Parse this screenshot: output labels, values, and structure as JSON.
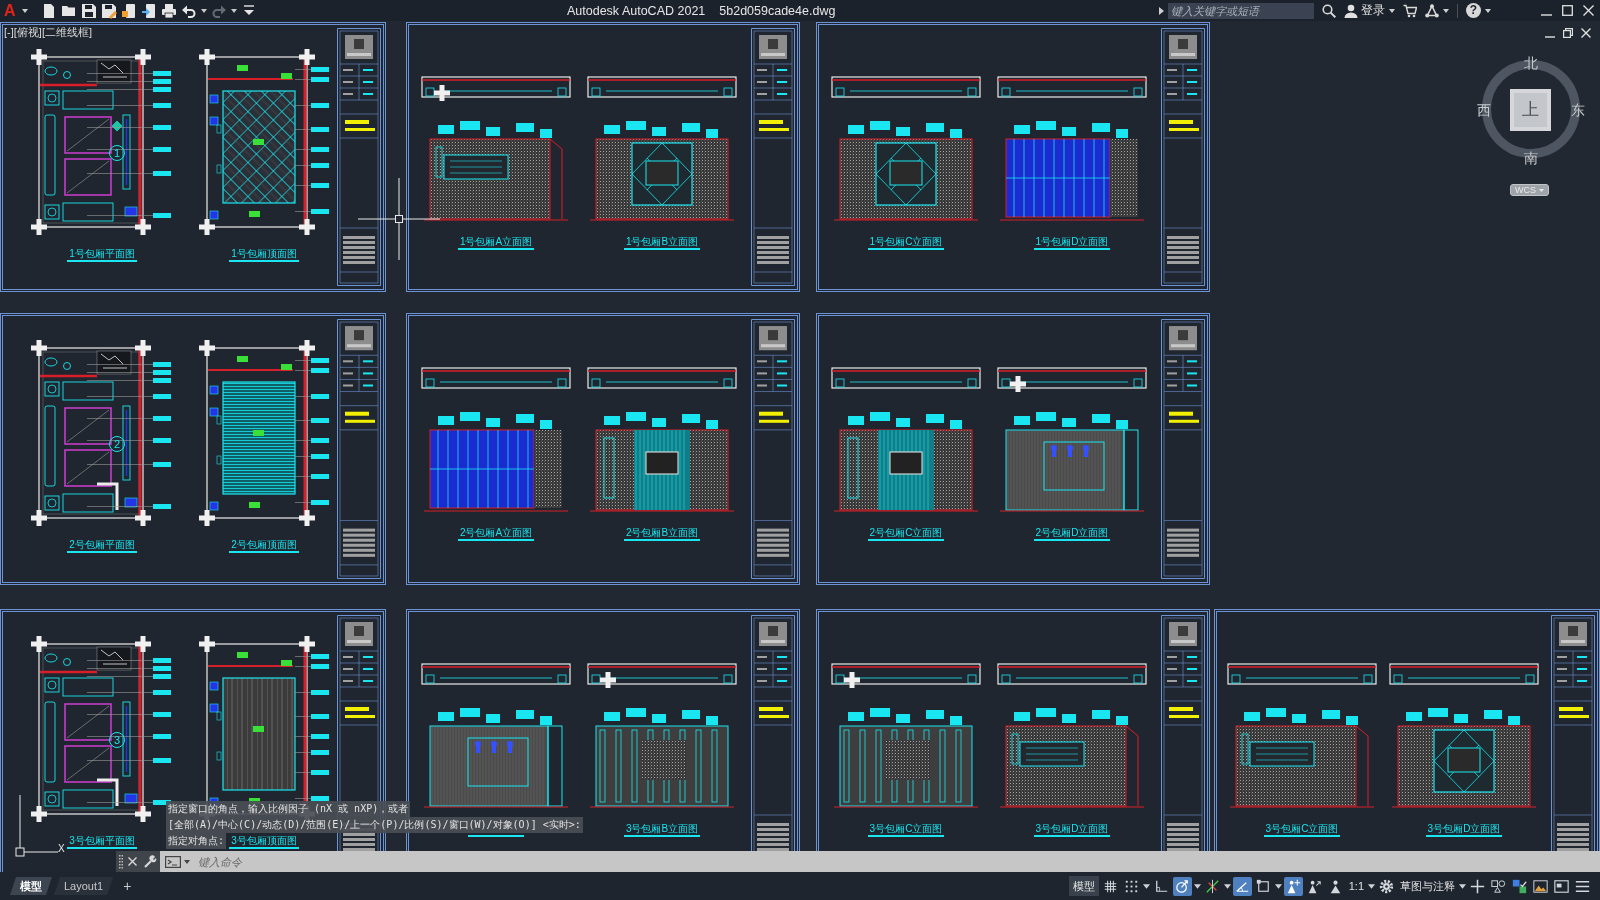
{
  "title_bar": {
    "logo": "A",
    "quick_access": [
      {
        "kind": "new"
      },
      {
        "kind": "open"
      },
      {
        "kind": "save"
      },
      {
        "kind": "saveas"
      },
      {
        "kind": "webopen"
      },
      {
        "kind": "websave"
      },
      {
        "kind": "plot"
      },
      {
        "kind": "undo",
        "disabled": false
      },
      {
        "kind": "caret"
      },
      {
        "kind": "redo",
        "disabled": true
      },
      {
        "kind": "caret"
      },
      {
        "kind": "customize"
      }
    ],
    "app_name": "Autodesk AutoCAD 2021",
    "file_name": "5b2d059cade4e.dwg",
    "search": {
      "placeholder": "键入关键字或短语"
    },
    "sign_in": "登录",
    "help": "?"
  },
  "viewport": {
    "controls": [
      "[-]",
      "[俯视]",
      "[二维线框]"
    ]
  },
  "sheet_rows": [
    {
      "sheets": [
        {
          "drawings": [
            {
              "kind": "plan",
              "caption": "1号包厢平面图",
              "marker": "1"
            },
            {
              "kind": "ceiling",
              "caption": "1号包厢顶面图"
            }
          ]
        },
        {
          "drawings": [
            {
              "kind": "elevation",
              "caption": "1号包厢A立面图"
            },
            {
              "kind": "elevation",
              "caption": "1号包厢B立面图"
            }
          ]
        },
        {
          "drawings": [
            {
              "kind": "elevation",
              "caption": "1号包厢C立面图"
            },
            {
              "kind": "elevation",
              "caption": "1号包厢D立面图"
            }
          ]
        }
      ]
    },
    {
      "sheets": [
        {
          "drawings": [
            {
              "kind": "plan",
              "caption": "2号包厢平面图",
              "marker": "2"
            },
            {
              "kind": "ceiling",
              "caption": "2号包厢顶面图"
            }
          ]
        },
        {
          "drawings": [
            {
              "kind": "elevation",
              "caption": "2号包厢A立面图"
            },
            {
              "kind": "elevation",
              "caption": "2号包厢B立面图"
            }
          ]
        },
        {
          "drawings": [
            {
              "kind": "elevation",
              "caption": "2号包厢C立面图"
            },
            {
              "kind": "elevation",
              "caption": "2号包厢D立面图"
            }
          ]
        }
      ]
    },
    {
      "sheets": [
        {
          "drawings": [
            {
              "kind": "plan",
              "caption": "3号包厢平面图",
              "marker": "3"
            },
            {
              "kind": "ceiling",
              "caption": "3号包厢顶面图"
            }
          ]
        },
        {
          "drawings": [
            {
              "kind": "elevation"
            },
            {
              "kind": "elevation",
              "caption": "3号包厢B立面图"
            }
          ]
        },
        {
          "drawings": [
            {
              "kind": "elevation",
              "caption": "3号包厢C立面图"
            },
            {
              "kind": "elevation",
              "caption": "3号包厢D立面图"
            }
          ]
        },
        {
          "drawings": [
            {
              "kind": "elevation",
              "caption": "3号包厢C立面图"
            },
            {
              "kind": "elevation",
              "caption": "3号包厢D立面图"
            }
          ]
        }
      ]
    }
  ],
  "view_cube": {
    "north": "北",
    "south": "南",
    "west": "西",
    "east": "东",
    "face": "上",
    "ucs_menu": "WCS"
  },
  "ucs_icon": {
    "x_label": "X"
  },
  "command_line": {
    "history": [
      "指定窗口的角点，输入比例因子 (nX 或 nXP)，或者",
      "[全部(A)/中心(C)/动态(D)/范围(E)/上一个(P)/比例(S)/窗口(W)/对象(O)] <实时>:",
      "指定对角点:"
    ],
    "placeholder": "键入命令"
  },
  "layout_tabs": [
    {
      "label": "模型",
      "selected": true
    },
    {
      "label": "Layout1",
      "selected": false
    }
  ],
  "add_layout": "+",
  "status_bar": [
    {
      "kind": "space",
      "label": "模型"
    },
    {
      "kind": "grid",
      "on": false
    },
    {
      "kind": "snap",
      "on": false
    },
    {
      "kind": "caret"
    },
    {
      "kind": "ortho",
      "on": false
    },
    {
      "kind": "polar",
      "on": true
    },
    {
      "kind": "caret"
    },
    {
      "kind": "isodraft",
      "on": false
    },
    {
      "kind": "caret"
    },
    {
      "kind": "tracking",
      "on": true
    },
    {
      "kind": "osnap",
      "on": false
    },
    {
      "kind": "caret"
    },
    {
      "kind": "annovis",
      "on": true
    },
    {
      "kind": "autoscale",
      "on": false
    },
    {
      "kind": "annoscale"
    },
    {
      "kind": "text",
      "label": "1:1"
    },
    {
      "kind": "caret"
    },
    {
      "kind": "gear"
    },
    {
      "kind": "text",
      "label": "草图与注释"
    },
    {
      "kind": "caret"
    },
    {
      "kind": "plus"
    },
    {
      "kind": "isolate"
    },
    {
      "kind": "hardware"
    },
    {
      "kind": "cleanscreen"
    },
    {
      "kind": "properties"
    },
    {
      "kind": "menu"
    }
  ]
}
